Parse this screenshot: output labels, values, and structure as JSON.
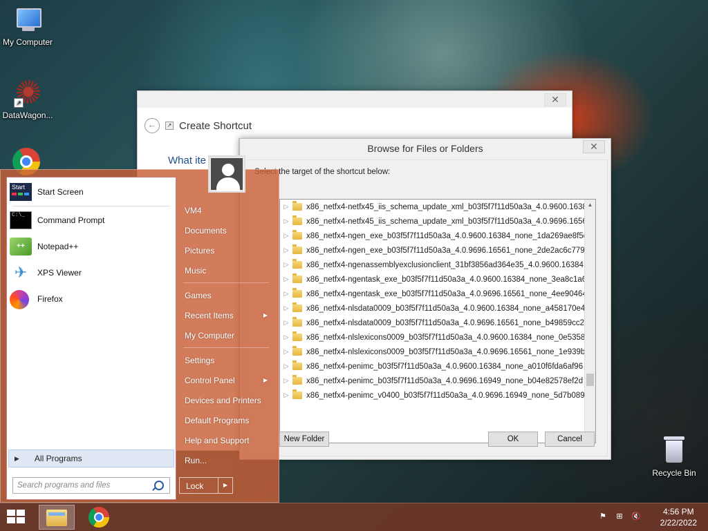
{
  "desktop": {
    "icons": [
      {
        "label": "My Computer"
      },
      {
        "label": "DataWagon..."
      },
      {
        "label": "Recycle Bin"
      }
    ]
  },
  "create_shortcut": {
    "title": "Create Shortcut",
    "heading": "What ite",
    "close_glyph": "✕"
  },
  "browse_dialog": {
    "title": "Browse for Files or Folders",
    "instruction": "Select the target of the shortcut below:",
    "tree_items": [
      "x86_netfx4-netfx45_iis_schema_update_xml_b03f5f7f11d50a3a_4.0.9600.1638",
      "x86_netfx4-netfx45_iis_schema_update_xml_b03f5f7f11d50a3a_4.0.9696.1656",
      "x86_netfx4-ngen_exe_b03f5f7f11d50a3a_4.0.9600.16384_none_1da269ae8f5d",
      "x86_netfx4-ngen_exe_b03f5f7f11d50a3a_4.0.9696.16561_none_2de2ac6c779e",
      "x86_netfx4-ngenassemblyexclusionclient_31bf3856ad364e35_4.0.9600.16384",
      "x86_netfx4-ngentask_exe_b03f5f7f11d50a3a_4.0.9600.16384_none_3ea8c1a62",
      "x86_netfx4-ngentask_exe_b03f5f7f11d50a3a_4.0.9696.16561_none_4ee904640",
      "x86_netfx4-nlsdata0009_b03f5f7f11d50a3a_4.0.9600.16384_none_a458170e42",
      "x86_netfx4-nlsdata0009_b03f5f7f11d50a3a_4.0.9696.16561_none_b49859cc2b",
      "x86_netfx4-nlslexicons0009_b03f5f7f11d50a3a_4.0.9600.16384_none_0e53588",
      "x86_netfx4-nlslexicons0009_b03f5f7f11d50a3a_4.0.9696.16561_none_1e939b2",
      "x86_netfx4-penimc_b03f5f7f11d50a3a_4.0.9600.16384_none_a010f6fda6af96",
      "x86_netfx4-penimc_b03f5f7f11d50a3a_4.0.9696.16949_none_b04e82578ef2d",
      "x86_netfx4-penimc_v0400_b03f5f7f11d50a3a_4.0.9696.16949_none_5d7b089"
    ],
    "new_folder_label": "New Folder",
    "ok_label": "OK",
    "cancel_label": "Cancel"
  },
  "start_menu": {
    "pinned": [
      {
        "label": "Start Screen",
        "icon": "start-screen-icon"
      },
      {
        "label": "Command Prompt",
        "icon": "command-prompt-icon"
      },
      {
        "label": "Notepad++",
        "icon": "notepadpp-icon"
      },
      {
        "label": "XPS Viewer",
        "icon": "xps-viewer-icon"
      },
      {
        "label": "Firefox",
        "icon": "firefox-icon"
      }
    ],
    "start_icon_text": "Start",
    "cmd_icon_text": "C:\\_",
    "npp_icon_text": "++",
    "all_programs": "All Programs",
    "search_placeholder": "Search programs and files",
    "right_items": [
      {
        "label": "VM4"
      },
      {
        "label": "Documents"
      },
      {
        "label": "Pictures"
      },
      {
        "label": "Music"
      },
      {
        "label": "Games"
      },
      {
        "label": "Recent Items"
      },
      {
        "label": "My Computer"
      },
      {
        "label": "Settings"
      },
      {
        "label": "Control Panel"
      },
      {
        "label": "Devices and Printers"
      },
      {
        "label": "Default Programs"
      },
      {
        "label": "Help and Support"
      },
      {
        "label": "Run..."
      }
    ],
    "lock_label": "Lock"
  },
  "taskbar": {
    "time": "4:56 PM",
    "date": "2/22/2022"
  },
  "colors": {
    "start_menu_bg": "#c85f37",
    "taskbar_bg": "#6e3728",
    "link_blue": "#1f4e8c"
  }
}
